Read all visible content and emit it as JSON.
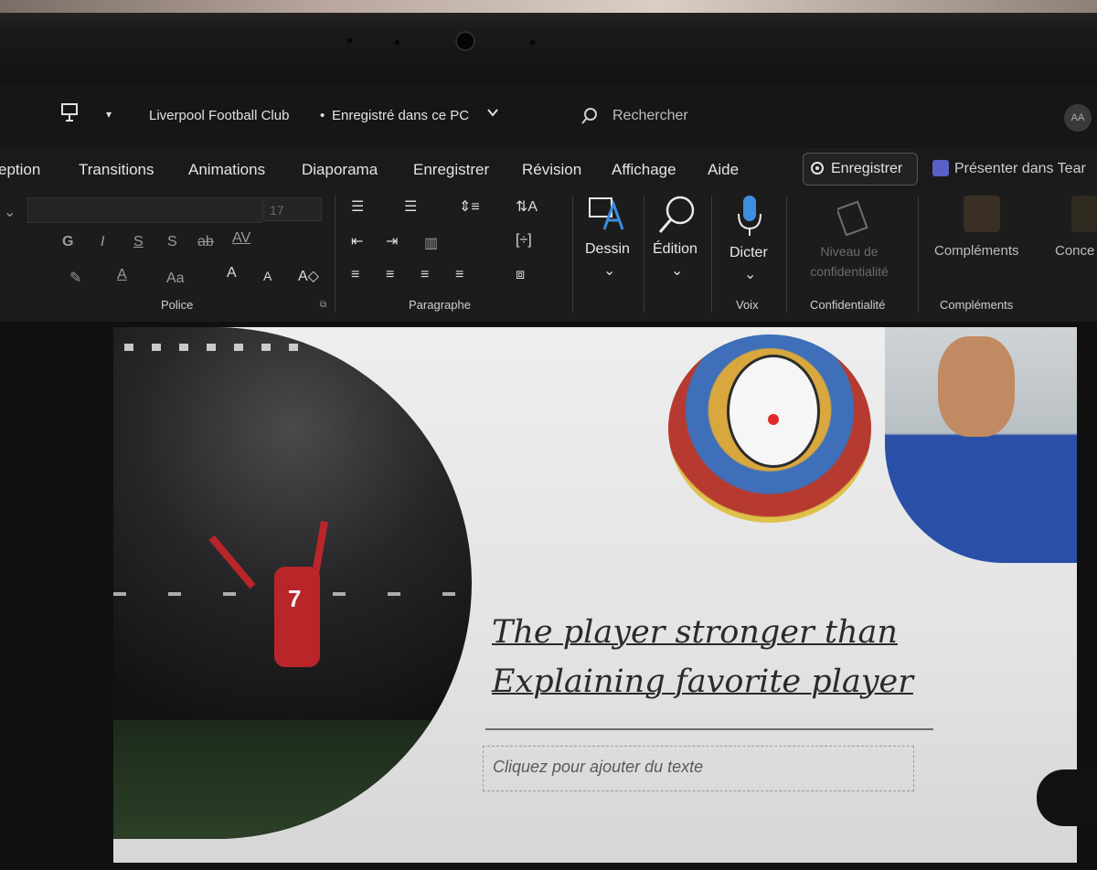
{
  "titlebar": {
    "document_title": "Liverpool Football Club",
    "separator": "•",
    "save_status": "Enregistré dans ce PC",
    "search_placeholder": "Rechercher",
    "avatar_initials": "AA"
  },
  "tabs": [
    {
      "label": "eption"
    },
    {
      "label": "Transitions"
    },
    {
      "label": "Animations"
    },
    {
      "label": "Diaporama"
    },
    {
      "label": "Enregistrer"
    },
    {
      "label": "Révision"
    },
    {
      "label": "Affichage"
    },
    {
      "label": "Aide"
    }
  ],
  "record_button": {
    "label": "Enregistrer"
  },
  "present_button": {
    "label": "Présenter dans Tear"
  },
  "ribbon": {
    "font_size_value": "17",
    "groups": {
      "police": "Police",
      "paragraphe": "Paragraphe",
      "voix": "Voix",
      "confidentialite": "Confidentialité",
      "complements": "Compléments"
    },
    "buttons": {
      "dessin": "Dessin",
      "edition": "Édition",
      "dicter": "Dicter",
      "niveau": "Niveau de confidentialité",
      "complements": "Compléments",
      "concepteur": "Conce"
    },
    "font_glyphs": {
      "bold": "G",
      "italic": "I",
      "underline": "S",
      "shadow": "S",
      "spacing": "AV",
      "case": "Aa",
      "grow": "A",
      "shrink": "A"
    }
  },
  "slide": {
    "title_line1": "The player stronger than",
    "title_line2": "Explaining favorite player",
    "subtitle_placeholder": "Cliquez pour ajouter du texte",
    "player_number": "7"
  },
  "icons": {
    "pin": "pin-icon",
    "undo": "undo-icon",
    "search": "search-icon",
    "draw": "draw-icon",
    "find": "magnifier-icon",
    "mic": "microphone-icon"
  },
  "colors": {
    "accent_blue": "#2b7cd3",
    "slide_bg": "#e8e8e8",
    "jersey_red": "#b8262a"
  }
}
